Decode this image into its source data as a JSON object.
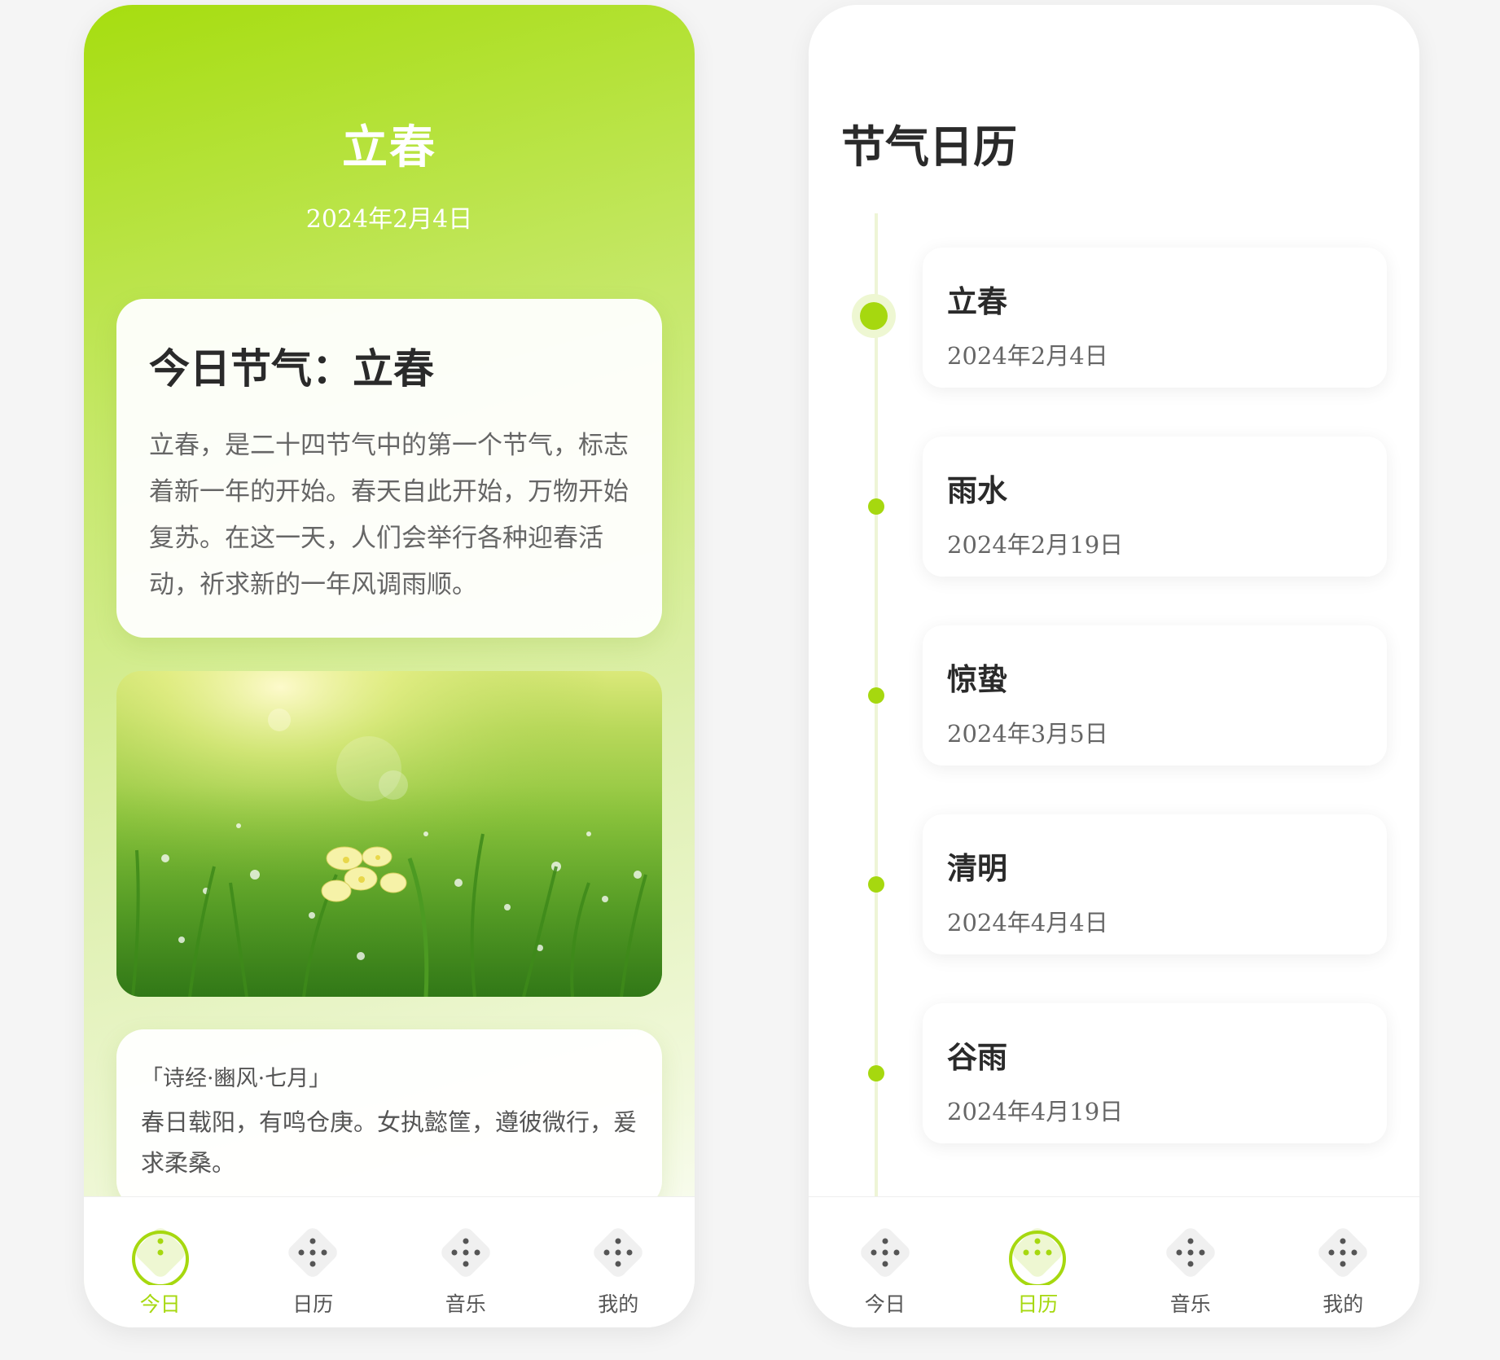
{
  "colors": {
    "accent": "#a6d80f",
    "gradient_top": "#a6dd0f",
    "text_dark": "#2a2a2a",
    "text_body": "#666666"
  },
  "left_screen": {
    "hero": {
      "title": "立春",
      "date": "2024年2月4日"
    },
    "intro_card": {
      "title": "今日节气：立春",
      "body": "立春，是二十四节气中的第一个节气，标志着新一年的开始。春天自此开始，万物开始复苏。在这一天，人们会举行各种迎春活动，祈求新的一年风调雨顺。"
    },
    "photo": {
      "subject": "spring-grass-with-dew-and-primrose"
    },
    "poem_card": {
      "source": "「诗经·豳风·七月」",
      "text": "春日载阳，有鸣仓庚。女执懿筐，遵彼微行，爰求柔桑。"
    },
    "tabbar": {
      "tabs": [
        {
          "label": "今日",
          "icon": "dots-icon",
          "active": true
        },
        {
          "label": "日历",
          "icon": "dots-icon",
          "active": false
        },
        {
          "label": "音乐",
          "icon": "dots-icon",
          "active": false
        },
        {
          "label": "我的",
          "icon": "dots-icon",
          "active": false
        }
      ]
    }
  },
  "right_screen": {
    "title": "节气日历",
    "terms": [
      {
        "name": "立春",
        "date": "2024年2月4日",
        "current": true
      },
      {
        "name": "雨水",
        "date": "2024年2月19日",
        "current": false
      },
      {
        "name": "惊蛰",
        "date": "2024年3月5日",
        "current": false
      },
      {
        "name": "清明",
        "date": "2024年4月4日",
        "current": false
      },
      {
        "name": "谷雨",
        "date": "2024年4月19日",
        "current": false
      }
    ],
    "tabbar": {
      "tabs": [
        {
          "label": "今日",
          "icon": "dots-icon",
          "active": false
        },
        {
          "label": "日历",
          "icon": "dots-icon",
          "active": true
        },
        {
          "label": "音乐",
          "icon": "dots-icon",
          "active": false
        },
        {
          "label": "我的",
          "icon": "dots-icon",
          "active": false
        }
      ]
    }
  }
}
